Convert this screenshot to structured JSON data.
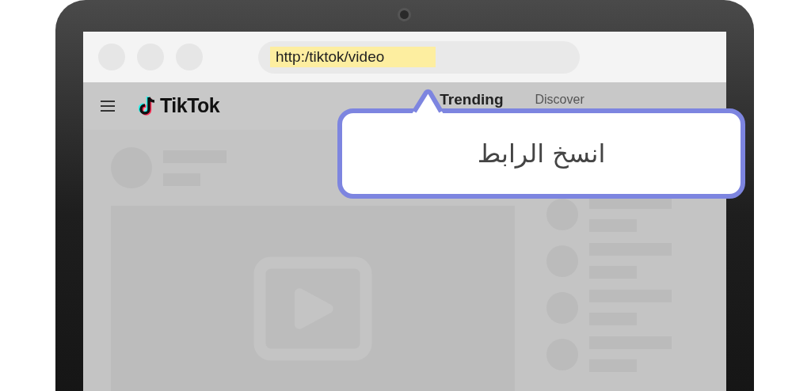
{
  "browser": {
    "address": "http:/tiktok/video",
    "address_highlighted": true
  },
  "site": {
    "logo": "TikTok",
    "nav": [
      {
        "label": "Trending",
        "selected": true
      },
      {
        "label": "Discover",
        "selected": false
      }
    ]
  },
  "callout": {
    "text": "انسخ الرابط"
  }
}
